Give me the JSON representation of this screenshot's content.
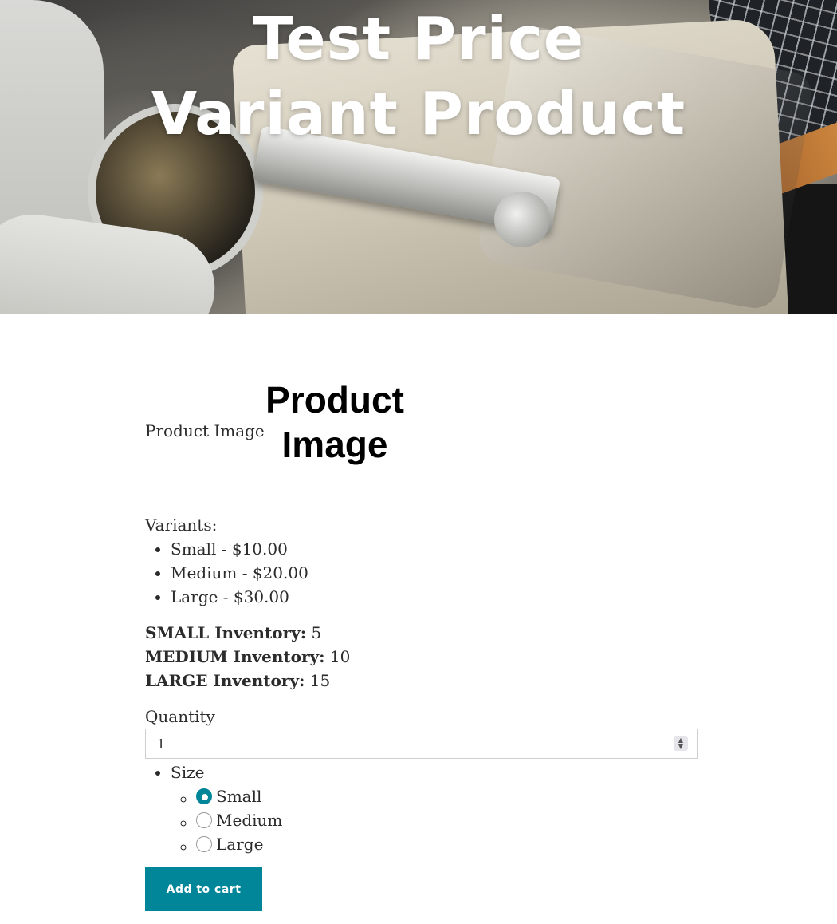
{
  "hero": {
    "title_line1": "Test Price",
    "title_line2": "Variant Product",
    "image_icon": "astronaut-spacewalk-image"
  },
  "product": {
    "image_alt": "Product Image",
    "image_placeholder_line1": "Product",
    "image_placeholder_line2": "Image"
  },
  "variants": {
    "label": "Variants:",
    "items": [
      {
        "text": "Small - $10.00"
      },
      {
        "text": "Medium - $20.00"
      },
      {
        "text": "Large - $30.00"
      }
    ]
  },
  "inventory": [
    {
      "label": "SMALL Inventory:",
      "value": " 5"
    },
    {
      "label": "MEDIUM Inventory:",
      "value": " 10"
    },
    {
      "label": "LARGE Inventory:",
      "value": " 15"
    }
  ],
  "quantity": {
    "label": "Quantity",
    "value": "1"
  },
  "size": {
    "label": "Size",
    "options": [
      {
        "label": "Small",
        "checked": true
      },
      {
        "label": "Medium",
        "checked": false
      },
      {
        "label": "Large",
        "checked": false
      }
    ]
  },
  "cart": {
    "button_label": "Add to cart"
  },
  "colors": {
    "accent": "#008599",
    "text": "#2b2b2b",
    "input_border": "#cfcfcf"
  }
}
